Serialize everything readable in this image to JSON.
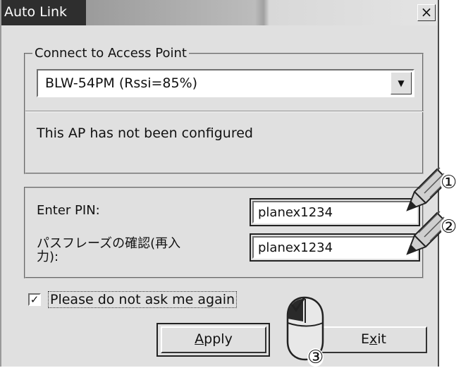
{
  "window": {
    "title": "Auto Link",
    "close_glyph": "×"
  },
  "group_ap": {
    "legend": "Connect to Access Point"
  },
  "ap_select": {
    "value": "BLW-54PM (Rssi=85%)"
  },
  "status_message": "This AP has not been configured",
  "pin": {
    "label": "Enter PIN:",
    "value": "planex1234"
  },
  "pin_confirm": {
    "label": "パスフレーズの確認(再入\n力):",
    "value": "planex1234"
  },
  "checkbox": {
    "checked": true,
    "label": "Please do not ask me again"
  },
  "buttons": {
    "apply_label": "Apply",
    "apply_mnemonic": "A",
    "apply_rest": "pply",
    "exit_label": "Exit",
    "exit_pre": "E",
    "exit_mnemonic": "x",
    "exit_rest": "it"
  },
  "callouts": {
    "one": "①",
    "two": "②",
    "three": "③"
  }
}
